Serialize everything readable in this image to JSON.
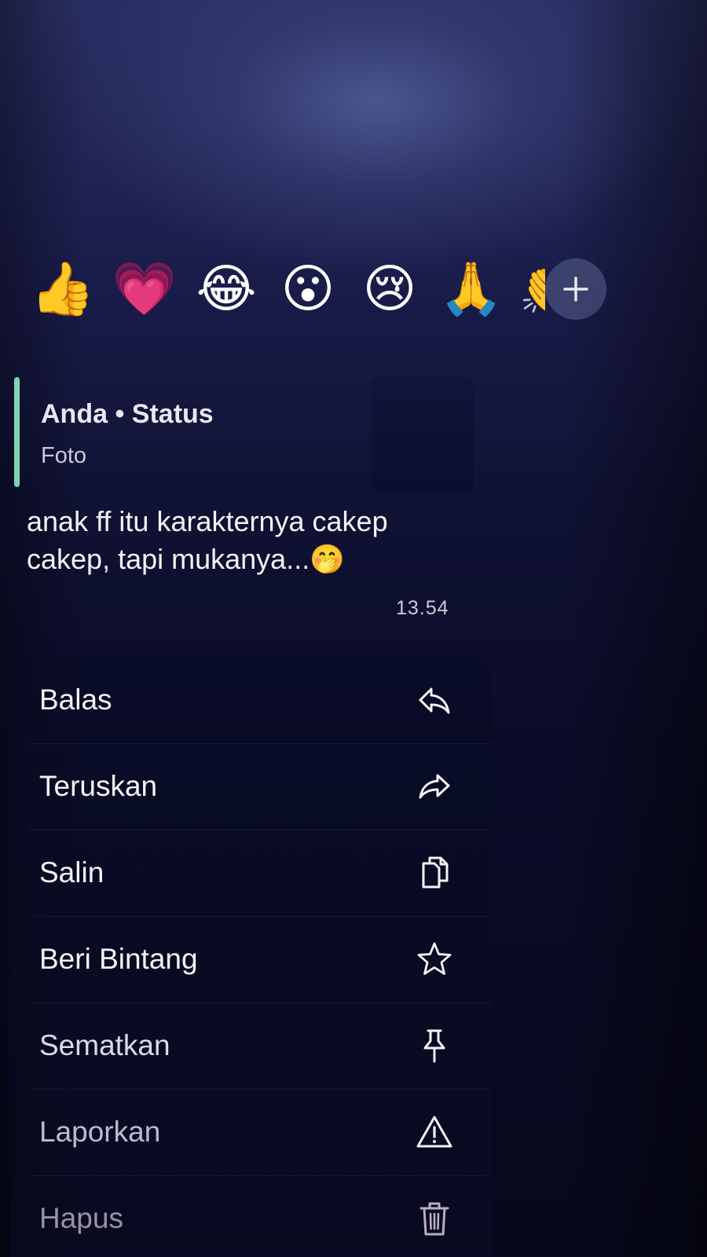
{
  "reactions": [
    {
      "emoji": "👍",
      "name": "thumbs-up"
    },
    {
      "emoji": "💗",
      "name": "heart"
    },
    {
      "emoji": "😂",
      "name": "laughing-tears"
    },
    {
      "emoji": "😮",
      "name": "surprised-face"
    },
    {
      "emoji": "😢",
      "name": "crying-face"
    },
    {
      "emoji": "🙏",
      "name": "folded-hands"
    },
    {
      "emoji": "👏",
      "name": "clapping-hands"
    }
  ],
  "reaction_more_icon": "plus-icon",
  "message": {
    "quote": {
      "title": "Anda • Status",
      "subtitle": "Foto",
      "accent_color": "#7fd3b5"
    },
    "text": "anak ff itu karakternya cakep cakep, tapi mukanya...🤭",
    "time": "13.54"
  },
  "menu": {
    "items": [
      {
        "label": "Balas",
        "icon": "reply-icon"
      },
      {
        "label": "Teruskan",
        "icon": "forward-icon"
      },
      {
        "label": "Salin",
        "icon": "copy-icon"
      },
      {
        "label": "Beri Bintang",
        "icon": "star-icon"
      },
      {
        "label": "Sematkan",
        "icon": "pin-icon"
      },
      {
        "label": "Laporkan",
        "icon": "warning-icon"
      },
      {
        "label": "Hapus",
        "icon": "trash-icon"
      }
    ]
  }
}
